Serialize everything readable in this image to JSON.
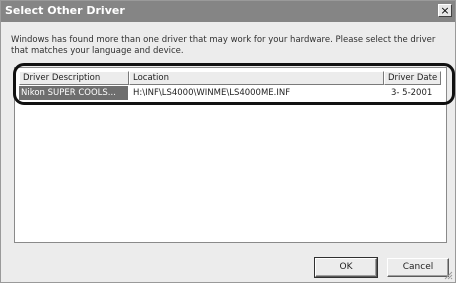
{
  "window": {
    "title": "Select Other Driver",
    "close_glyph": "×"
  },
  "message": "Windows has found more than one driver that may work for your hardware.  Please select the driver that matches your language and device.",
  "list": {
    "columns": [
      "Driver Description",
      "Location",
      "Driver Date"
    ],
    "rows": [
      {
        "description": "Nikon SUPER COOLS...",
        "location": "H:\\INF\\LS4000\\WINME\\LS4000ME.INF",
        "date": "3- 5-2001"
      }
    ]
  },
  "buttons": {
    "ok": "OK",
    "cancel": "Cancel"
  },
  "colors": {
    "titlebar": "#858585",
    "selection": "#6e6e6e",
    "highlight_ring": "#111111"
  }
}
